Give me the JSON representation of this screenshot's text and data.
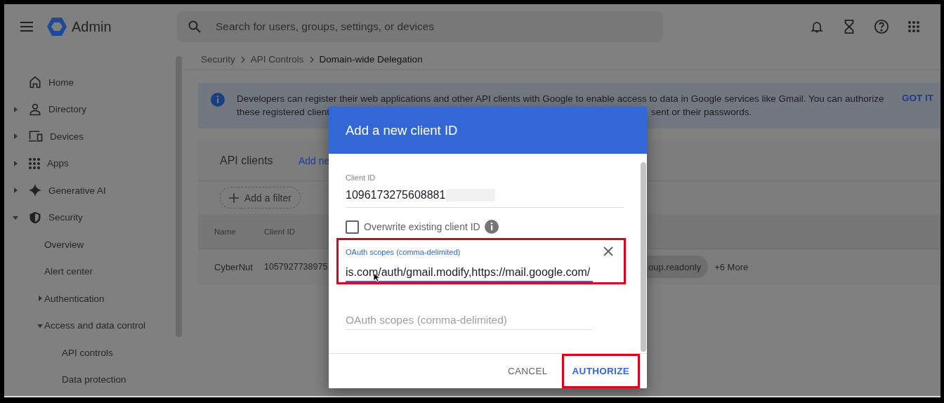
{
  "app": {
    "title": "Admin"
  },
  "search": {
    "placeholder": "Search for users, groups, settings, or devices"
  },
  "sidebar": {
    "items": [
      {
        "label": "Home"
      },
      {
        "label": "Directory",
        "expanded": false
      },
      {
        "label": "Devices",
        "expanded": false
      },
      {
        "label": "Apps",
        "expanded": false
      },
      {
        "label": "Generative AI",
        "expanded": false
      },
      {
        "label": "Security",
        "expanded": true,
        "children": [
          {
            "label": "Overview"
          },
          {
            "label": "Alert center"
          },
          {
            "label": "Authentication",
            "expanded": false
          },
          {
            "label": "Access and data control",
            "expanded": true,
            "children": [
              {
                "label": "API controls"
              },
              {
                "label": "Data protection"
              }
            ]
          }
        ]
      }
    ]
  },
  "breadcrumb": [
    "Security",
    "API Controls",
    "Domain-wide Delegation"
  ],
  "banner": {
    "line_1": "Developers can register their web applications and other API clients with Google to enable access to data in Google services like Gmail. You can authorize",
    "line_2_start": "these registered client",
    "line_2_end": "sent or their passwords.",
    "action": "GOT IT"
  },
  "card": {
    "title": "API clients",
    "link": "Add ne",
    "filter": "Add a filter",
    "columns": [
      "Name",
      "Client ID"
    ],
    "rows": [
      {
        "name": "CyberNut",
        "client_id": "1057927738975",
        "scope_chip": "oup.readonly",
        "more": "+6 More"
      }
    ]
  },
  "dialog": {
    "title": "Add a new client ID",
    "fields": [
      {
        "kind": "value",
        "label": "Client ID",
        "value": "1096173275608881",
        "redacted": true
      },
      {
        "kind": "checkbox",
        "label": "Overwrite existing client ID",
        "checked": false
      },
      {
        "kind": "focused",
        "label": "OAuth scopes (comma-delimited)",
        "value": "is.com/auth/gmail.modify,https://mail.google.com/",
        "highlighted": true
      },
      {
        "kind": "empty",
        "placeholder": "OAuth scopes (comma-delimited)"
      }
    ],
    "buttons": [
      {
        "label": "CANCEL",
        "primary": false,
        "highlighted": false
      },
      {
        "label": "AUTHORIZE",
        "primary": true,
        "highlighted": true
      }
    ]
  }
}
